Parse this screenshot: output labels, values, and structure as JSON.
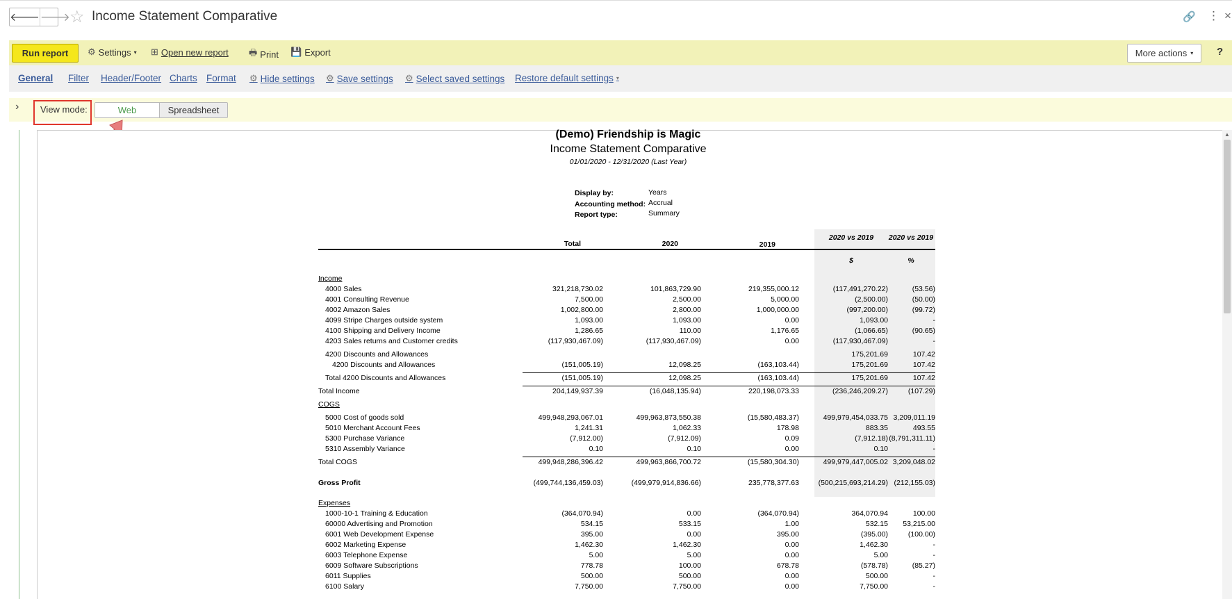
{
  "window": {
    "title": "Income Statement Comparative"
  },
  "toolbar": {
    "run_label": "Run report",
    "settings_label": "Settings",
    "open_new_label": "Open new report",
    "print_label": "Print",
    "export_label": "Export",
    "more_actions_label": "More actions",
    "help_label": "?"
  },
  "tabs": [
    {
      "label": "General"
    },
    {
      "label": "Filter"
    },
    {
      "label": "Header/Footer"
    },
    {
      "label": "Charts"
    },
    {
      "label": "Format"
    },
    {
      "label": "Hide settings"
    },
    {
      "label": "Save settings"
    },
    {
      "label": "Select saved settings"
    },
    {
      "label": "Restore default settings"
    }
  ],
  "view_mode": {
    "label": "View mode:",
    "options": [
      "Web",
      "Spreadsheet"
    ],
    "selected": "Web"
  },
  "report": {
    "company": "(Demo) Friendship is Magic",
    "title": "Income Statement Comparative",
    "period": "01/01/2020 - 12/31/2020 (Last Year)",
    "meta": [
      {
        "label": "Display by:",
        "value": "Years"
      },
      {
        "label": "Accounting method:",
        "value": "Accrual"
      },
      {
        "label": "Report type:",
        "value": "Summary"
      }
    ],
    "columns": {
      "total": "Total",
      "y2020": "2020",
      "y2019": "2019",
      "diff": "2020 vs 2019",
      "pct": "2020 vs 2019",
      "diff_unit": "$",
      "pct_unit": "%"
    },
    "rows": [
      {
        "label": "Income",
        "kind": "sec",
        "v": [
          "",
          "",
          "",
          "",
          ""
        ]
      },
      {
        "label": "4000 Sales",
        "kind": "l1",
        "v": [
          "321,218,730.02",
          "101,863,729.90",
          "219,355,000.12",
          "(117,491,270.22)",
          "(53.56)"
        ]
      },
      {
        "label": "4001 Consulting Revenue",
        "kind": "l1",
        "v": [
          "7,500.00",
          "2,500.00",
          "5,000.00",
          "(2,500.00)",
          "(50.00)"
        ]
      },
      {
        "label": "4002 Amazon Sales",
        "kind": "l1",
        "v": [
          "1,002,800.00",
          "2,800.00",
          "1,000,000.00",
          "(997,200.00)",
          "(99.72)"
        ]
      },
      {
        "label": "4099 Stripe Charges outside system",
        "kind": "l1",
        "v": [
          "1,093.00",
          "1,093.00",
          "0.00",
          "1,093.00",
          "-"
        ]
      },
      {
        "label": "4100 Shipping and Delivery Income",
        "kind": "l1",
        "v": [
          "1,286.65",
          "110.00",
          "1,176.65",
          "(1,066.65)",
          "(90.65)"
        ]
      },
      {
        "label": "4203 Sales returns and Customer credits",
        "kind": "l1",
        "v": [
          "(117,930,467.09)",
          "(117,930,467.09)",
          "0.00",
          "(117,930,467.09)",
          "-"
        ]
      },
      {
        "label": "4200 Discounts and Allowances",
        "kind": "l1",
        "v": [
          "",
          "",
          "",
          "175,201.69",
          "107.42"
        ]
      },
      {
        "label": "4200 Discounts and Allowances",
        "kind": "l2",
        "v": [
          "(151,005.19)",
          "12,098.25",
          "(163,103.44)",
          "175,201.69",
          "107.42"
        ]
      },
      {
        "label": "Total 4200 Discounts and Allowances",
        "kind": "l1",
        "v": [
          "(151,005.19)",
          "12,098.25",
          "(163,103.44)",
          "175,201.69",
          "107.42"
        ]
      },
      {
        "label": "Total Income",
        "kind": "top",
        "v": [
          "204,149,937.39",
          "(16,048,135.94)",
          "220,198,073.33",
          "(236,246,209.27)",
          "(107.29)"
        ]
      },
      {
        "label": "COGS",
        "kind": "sec",
        "v": [
          "",
          "",
          "",
          "",
          ""
        ]
      },
      {
        "label": "5000 Cost of goods sold",
        "kind": "l1",
        "v": [
          "499,948,293,067.01",
          "499,963,873,550.38",
          "(15,580,483.37)",
          "499,979,454,033.75",
          "3,209,011.19"
        ]
      },
      {
        "label": "5010 Merchant Account Fees",
        "kind": "l1",
        "v": [
          "1,241.31",
          "1,062.33",
          "178.98",
          "883.35",
          "493.55"
        ]
      },
      {
        "label": "5300 Purchase Variance",
        "kind": "l1",
        "v": [
          "(7,912.00)",
          "(7,912.09)",
          "0.09",
          "(7,912.18)",
          "(8,791,311.11)"
        ]
      },
      {
        "label": "5310 Assembly Variance",
        "kind": "l1",
        "v": [
          "0.10",
          "0.10",
          "0.00",
          "0.10",
          "-"
        ]
      },
      {
        "label": "Total COGS",
        "kind": "top",
        "v": [
          "499,948,286,396.42",
          "499,963,866,700.72",
          "(15,580,304.30)",
          "499,979,447,005.02",
          "3,209,048.02"
        ]
      },
      {
        "label": "Gross Profit",
        "kind": "bold",
        "v": [
          "(499,744,136,459.03)",
          "(499,979,914,836.66)",
          "235,778,377.63",
          "(500,215,693,214.29)",
          "(212,155.03)"
        ]
      },
      {
        "label": "Expenses",
        "kind": "sec",
        "v": [
          "",
          "",
          "",
          "",
          ""
        ]
      },
      {
        "label": "1000-10-1 Training & Education",
        "kind": "l1",
        "v": [
          "(364,070.94)",
          "0.00",
          "(364,070.94)",
          "364,070.94",
          "100.00"
        ]
      },
      {
        "label": "60000 Advertising and Promotion",
        "kind": "l1",
        "v": [
          "534.15",
          "533.15",
          "1.00",
          "532.15",
          "53,215.00"
        ]
      },
      {
        "label": "6001 Web Development Expense",
        "kind": "l1",
        "v": [
          "395.00",
          "0.00",
          "395.00",
          "(395.00)",
          "(100.00)"
        ]
      },
      {
        "label": "6002 Marketing Expense",
        "kind": "l1",
        "v": [
          "1,462.30",
          "1,462.30",
          "0.00",
          "1,462.30",
          "-"
        ]
      },
      {
        "label": "6003 Telephone Expense",
        "kind": "l1",
        "v": [
          "5.00",
          "5.00",
          "0.00",
          "5.00",
          "-"
        ]
      },
      {
        "label": "6009 Software Subscriptions",
        "kind": "l1",
        "v": [
          "778.78",
          "100.00",
          "678.78",
          "(578.78)",
          "(85.27)"
        ]
      },
      {
        "label": "6011 Supplies",
        "kind": "l1",
        "v": [
          "500.00",
          "500.00",
          "0.00",
          "500.00",
          "-"
        ]
      },
      {
        "label": "6100 Salary",
        "kind": "l1",
        "v": [
          "7,750.00",
          "7,750.00",
          "0.00",
          "7,750.00",
          "-"
        ]
      }
    ]
  }
}
